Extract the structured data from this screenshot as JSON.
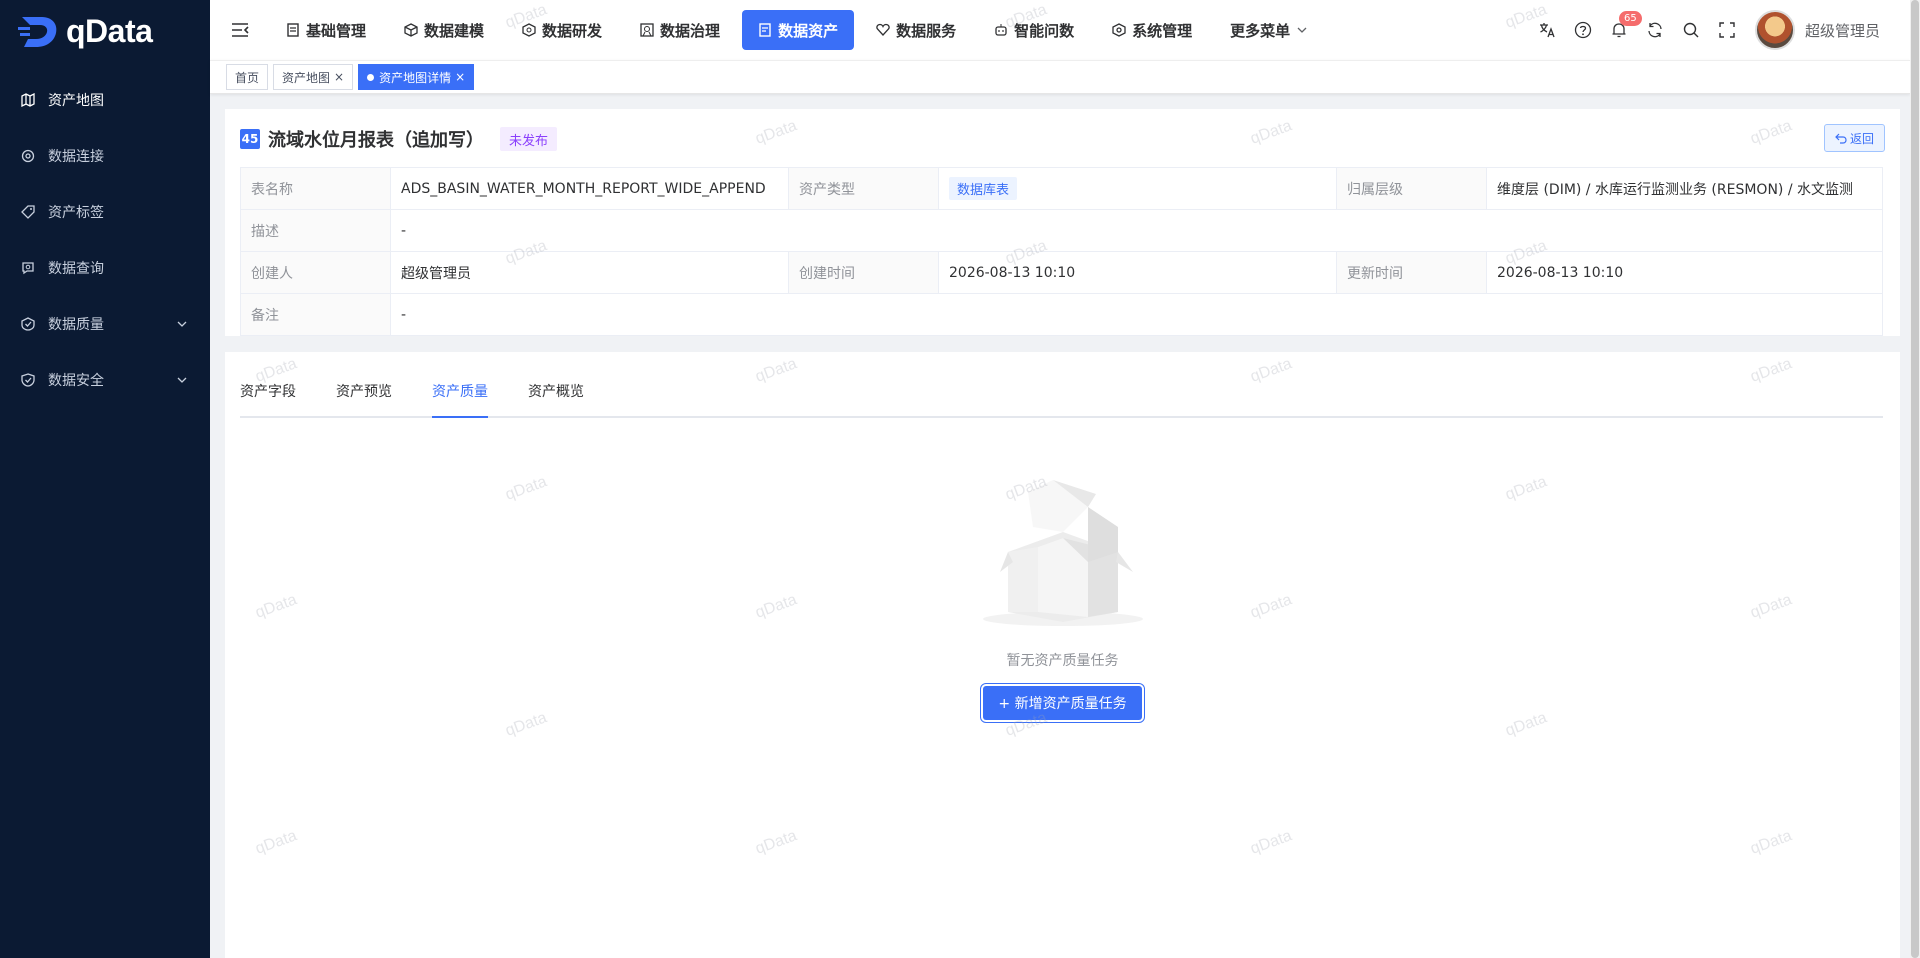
{
  "app": {
    "logo_text": "qData",
    "watermark": "qData"
  },
  "sidebar": {
    "items": [
      {
        "label": "资产地图",
        "icon": "map-icon",
        "active": true
      },
      {
        "label": "数据连接",
        "icon": "connection-icon"
      },
      {
        "label": "资产标签",
        "icon": "tag-icon"
      },
      {
        "label": "数据查询",
        "icon": "query-icon"
      },
      {
        "label": "数据质量",
        "icon": "quality-icon",
        "expandable": true
      },
      {
        "label": "数据安全",
        "icon": "security-icon",
        "expandable": true
      }
    ]
  },
  "topnav": {
    "items": [
      {
        "label": "基础管理",
        "icon": "base-icon"
      },
      {
        "label": "数据建模",
        "icon": "model-icon"
      },
      {
        "label": "数据研发",
        "icon": "dev-icon"
      },
      {
        "label": "数据治理",
        "icon": "governance-icon"
      },
      {
        "label": "数据资产",
        "icon": "asset-icon",
        "active": true
      },
      {
        "label": "数据服务",
        "icon": "service-icon"
      },
      {
        "label": "智能问数",
        "icon": "robot-icon"
      },
      {
        "label": "系统管理",
        "icon": "system-icon"
      },
      {
        "label": "更多菜单",
        "icon": "chevron-down-icon"
      }
    ],
    "notification_count": "65",
    "username": "超级管理员"
  },
  "tags": [
    {
      "label": "首页"
    },
    {
      "label": "资产地图",
      "closable": true
    },
    {
      "label": "资产地图详情",
      "closable": true,
      "active": true
    }
  ],
  "detail": {
    "icon_text": "45",
    "title": "流域水位月报表（追加写）",
    "status": "未发布",
    "back_label": "返回",
    "fields": {
      "table_name_label": "表名称",
      "table_name": "ADS_BASIN_WATER_MONTH_REPORT_WIDE_APPEND",
      "asset_type_label": "资产类型",
      "asset_type": "数据库表",
      "layer_label": "归属层级",
      "layer": "维度层 (DIM) / 水库运行监测业务 (RESMON) / 水文监测",
      "desc_label": "描述",
      "desc": "-",
      "creator_label": "创建人",
      "creator": "超级管理员",
      "created_label": "创建时间",
      "created": "2026-08-13 10:10",
      "updated_label": "更新时间",
      "updated": "2026-08-13 10:10",
      "remark_label": "备注",
      "remark": "-"
    }
  },
  "tabs": [
    {
      "label": "资产字段"
    },
    {
      "label": "资产预览"
    },
    {
      "label": "资产质量",
      "active": true
    },
    {
      "label": "资产概览"
    }
  ],
  "empty": {
    "text": "暂无资产质量任务",
    "button": "+ 新增资产质量任务"
  },
  "colors": {
    "primary": "#3a6ff7",
    "sidebar_bg": "#0b1a33",
    "status_text": "#8a3ffc"
  }
}
